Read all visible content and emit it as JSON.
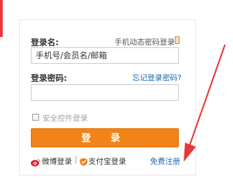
{
  "login": {
    "username_label": "登录名:",
    "dynamic_password_link": "手机动态密码登录",
    "username_placeholder": "手机号/会员名/邮箱",
    "password_label": "登录密码:",
    "forgot_password_link": "忘记登录密码?",
    "security_control_label": "安全控件登录",
    "login_button": "登 录",
    "weibo_login": "微博登录",
    "alipay_login": "支付宝登录",
    "register_link": "免费注册",
    "separator": "|"
  },
  "colors": {
    "accent_orange": "#f28319",
    "link_blue": "#1a66b3",
    "arrow_red": "#e8393a"
  },
  "icons": {
    "phone": "phone-icon",
    "weibo": "weibo-icon",
    "alipay": "alipay-icon",
    "arrow": "red-arrow-icon"
  }
}
